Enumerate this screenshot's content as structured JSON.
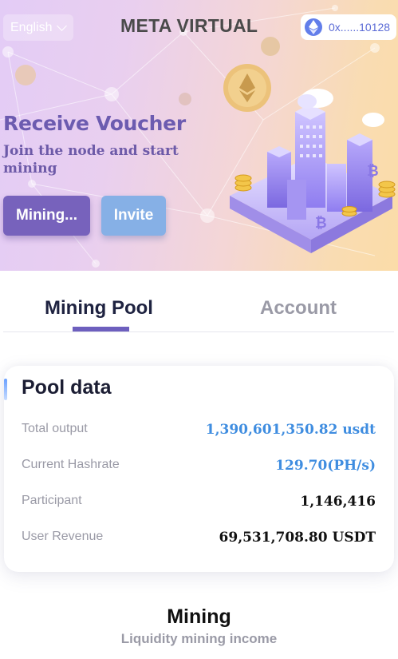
{
  "header": {
    "language": "English",
    "brand": "META VIRTUAL",
    "wallet_address": "0x......10128"
  },
  "hero": {
    "title": "Receive Voucher",
    "subtitle": "Join the node and start mining",
    "mining_button": "Mining...",
    "invite_button": "Invite"
  },
  "tabs": [
    {
      "label": "Mining Pool",
      "active": true
    },
    {
      "label": "Account",
      "active": false
    }
  ],
  "pool": {
    "title": "Pool data",
    "rows": [
      {
        "label": "Total output",
        "value": "1,390,601,350.82 usdt",
        "color": "#3f8de0"
      },
      {
        "label": "Current Hashrate",
        "value": "129.70(PH/s)",
        "color": "#3f8de0"
      },
      {
        "label": "Participant",
        "value": "1,146,416",
        "color": "#111111"
      },
      {
        "label": "User Revenue",
        "value": "69,531,708.80 USDT",
        "color": "#111111"
      }
    ]
  },
  "mining": {
    "title": "Mining",
    "subtitle": "Liquidity mining income"
  },
  "icons": {
    "language": "chevron-down-icon",
    "wallet": "ethereum-icon",
    "illustration": "crypto-city-illustration"
  },
  "colors": {
    "accent": "#6d5fbe",
    "value_blue": "#3f8de0",
    "hero_title": "#6c5bb0"
  }
}
